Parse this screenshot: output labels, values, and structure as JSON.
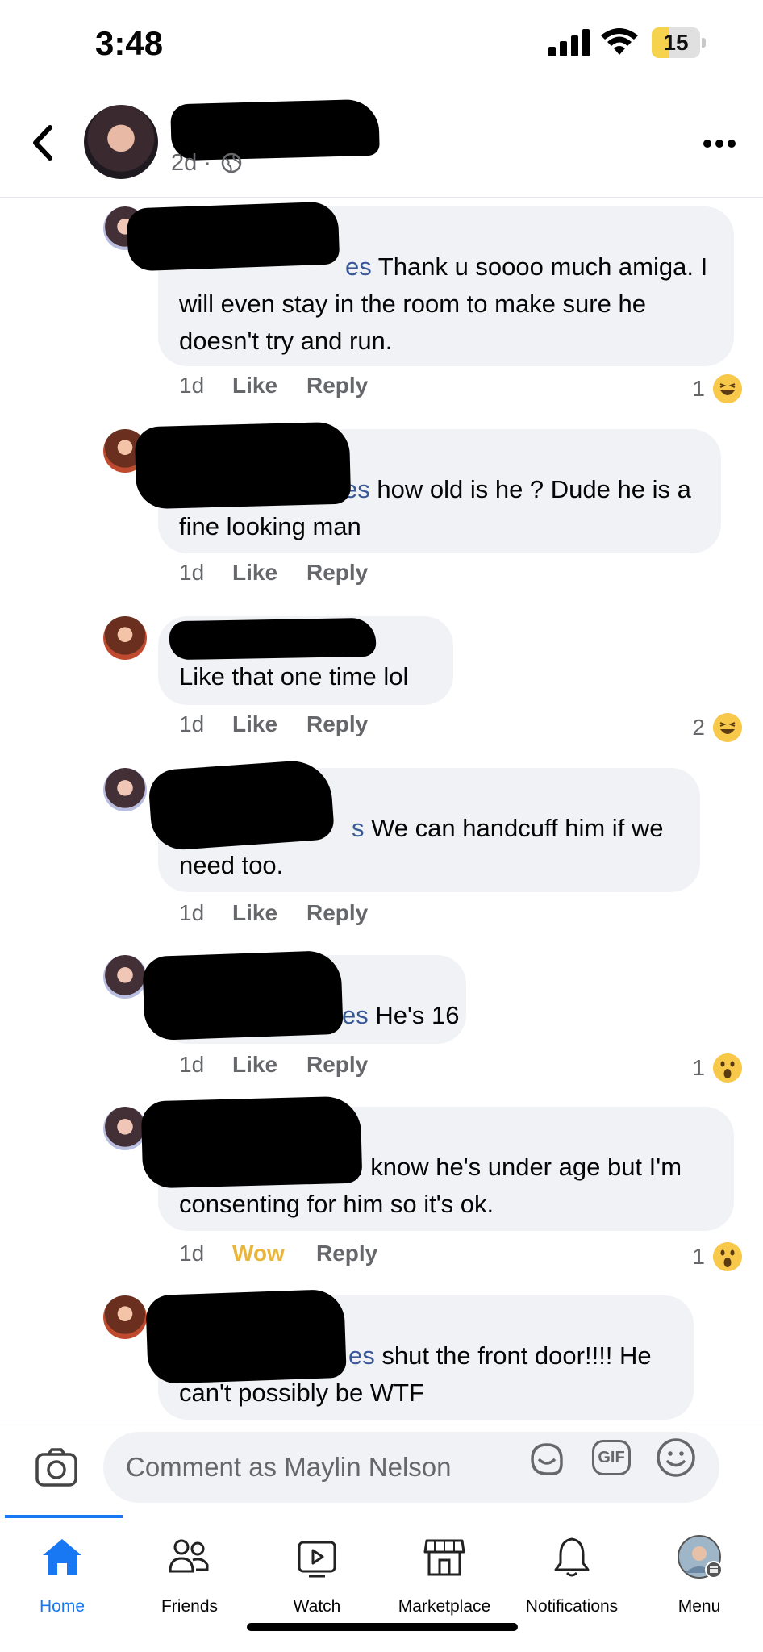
{
  "status_bar": {
    "time": "3:48",
    "battery": "15"
  },
  "post": {
    "age": "2d ·"
  },
  "comments": [
    {
      "tag_fragment": "es",
      "line1": " Thank u soooo much amiga. I",
      "line2": "will even stay in the room to make sure he",
      "line3": "doesn't try and run.",
      "time": "1d",
      "like_label": "Like",
      "reply_label": "Reply",
      "reaction_count": "1",
      "reaction": "laugh"
    },
    {
      "tag_fragment": "es",
      "line1": " how old is he ? Dude he is a",
      "line2": "fine looking man",
      "time": "1d",
      "like_label": "Like",
      "reply_label": "Reply"
    },
    {
      "line1": "Like that one time lol",
      "time": "1d",
      "like_label": "Like",
      "reply_label": "Reply",
      "reaction_count": "2",
      "reaction": "laugh"
    },
    {
      "tag_fragment": "s",
      "line1": " We can handcuff him if we",
      "line2": "need too.",
      "time": "1d",
      "like_label": "Like",
      "reply_label": "Reply"
    },
    {
      "tag_fragment": "es",
      "line1": " He's 16",
      "time": "1d",
      "like_label": "Like",
      "reply_label": "Reply",
      "reaction_count": "1",
      "reaction": "wow"
    },
    {
      "line1": "I know he's under age but I'm",
      "line2": "consenting for him so it's ok.",
      "time": "1d",
      "like_label": "Wow",
      "reply_label": "Reply",
      "reaction_count": "1",
      "reaction": "wow"
    },
    {
      "tag_fragment": "es",
      "line1": " shut the front door!!!! He",
      "line2": "can't possibly be WTF"
    }
  ],
  "composer": {
    "placeholder": "Comment as Maylin Nelson",
    "gif_label": "GIF"
  },
  "tabs": [
    {
      "label": "Home",
      "icon": "home-icon",
      "active": true
    },
    {
      "label": "Friends",
      "icon": "friends-icon"
    },
    {
      "label": "Watch",
      "icon": "watch-icon"
    },
    {
      "label": "Marketplace",
      "icon": "marketplace-icon"
    },
    {
      "label": "Notifications",
      "icon": "bell-icon"
    },
    {
      "label": "Menu",
      "icon": "profile-menu-icon"
    }
  ],
  "colors": {
    "accent": "#1877f2",
    "bubble": "#f0f2f5",
    "wow": "#e9b53b",
    "meta": "#65676b"
  }
}
